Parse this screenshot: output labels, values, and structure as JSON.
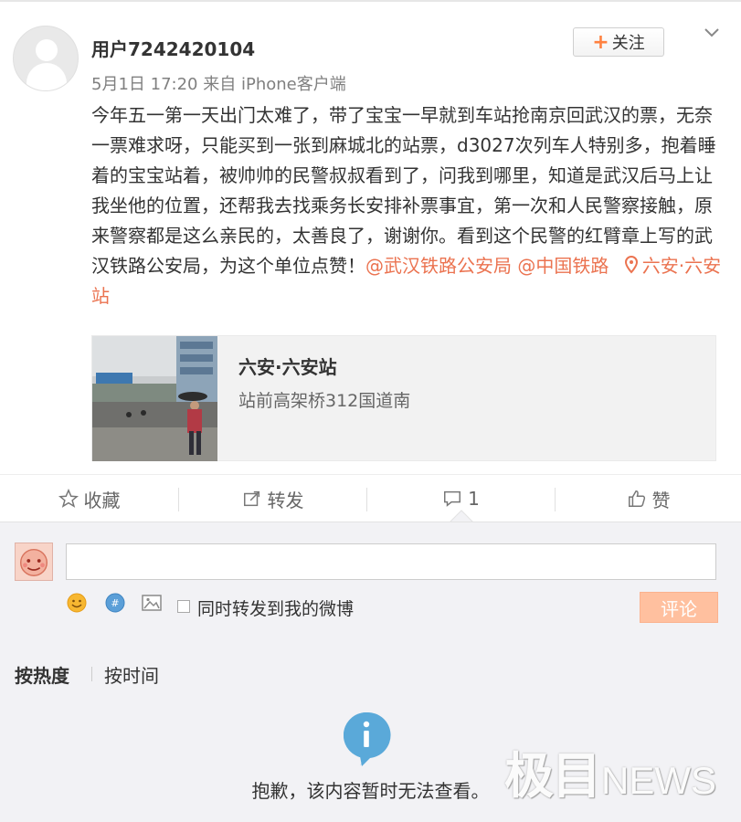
{
  "post": {
    "username": "用户7242420104",
    "date": "5月1日 17:20",
    "source_prefix": "来自",
    "source": "iPhone客户端",
    "follow_label": "关注",
    "follow_plus": "+",
    "text_body": "今年五一第一天出门太难了，带了宝宝一早就到车站抢南京回武汉的票，无奈一票难求呀，只能买到一张到麻城北的站票，d3027次列车人特别多，抱着睡着的宝宝站着，被帅帅的民警叔叔看到了，问我到哪里，知道是武汉后马上让我坐他的位置，还帮我去找乘务长安排补票事宜，第一次和人民警察接触，原来警察都是这么亲民的，太善良了，谢谢你。看到这个民警的红臂章上写的武汉铁路公安局，为这个单位点赞！",
    "mention_1": "@武汉铁路公安局",
    "mention_2": "@中国铁路",
    "location_tag": "六安·六安站",
    "location_card": {
      "title": "六安·六安站",
      "address": "站前高架桥312国道南"
    }
  },
  "actions": {
    "favorite": "收藏",
    "repost": "转发",
    "comment_count": "1",
    "like": "赞"
  },
  "comment_box": {
    "placeholder": "",
    "also_repost_label": "同时转发到我的微博",
    "submit_label": "评论"
  },
  "sort": {
    "by_hot": "按热度",
    "by_time": "按时间"
  },
  "empty_message": "抱歉，该内容暂时无法查看。",
  "watermark": {
    "cn": "极目",
    "en": "NEWS"
  },
  "colors": {
    "accent": "#eb7350",
    "submit_disabled": "#ffc09f",
    "info_blue": "#5aa9d9"
  }
}
